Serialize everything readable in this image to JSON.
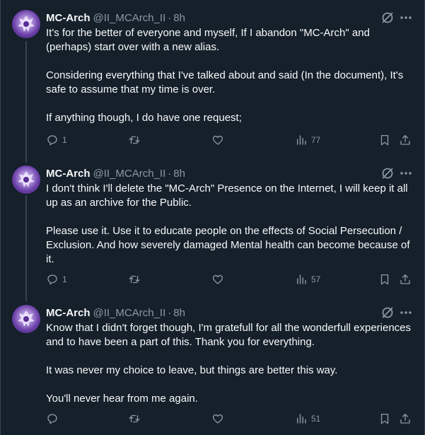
{
  "tweets": [
    {
      "name": "MC-Arch",
      "handle": "@II_MCArch_II",
      "separator": "·",
      "time": "8h",
      "paragraphs": [
        "It's for the better of everyone and myself, If I abandon \"MC-Arch\" and (perhaps) start over with a new alias.",
        "Considering everything that I've talked about and said (In the document), It's safe to assume that my time is over.",
        "If anything though, I do have one request;"
      ],
      "replies": "1",
      "retweets": "",
      "likes": "",
      "views": "77"
    },
    {
      "name": "MC-Arch",
      "handle": "@II_MCArch_II",
      "separator": "·",
      "time": "8h",
      "paragraphs": [
        "I don't think I'll delete the \"MC-Arch\" Presence on the Internet, I will keep it all up as an archive for the Public.",
        "Please use it. Use it to educate people on the effects of Social Persecution / Exclusion. And how severely damaged Mental health can become because of it."
      ],
      "replies": "1",
      "retweets": "",
      "likes": "",
      "views": "57"
    },
    {
      "name": "MC-Arch",
      "handle": "@II_MCArch_II",
      "separator": "·",
      "time": "8h",
      "paragraphs": [
        "Know that I didn't forget though, I'm gratefull for all the wonderfull experiences and to have been a part of this. Thank you for everything.",
        "It was never my choice to leave, but things are better this way.",
        "You'll never hear from me again."
      ],
      "replies": "",
      "retweets": "",
      "likes": "",
      "views": "51"
    }
  ],
  "icons": {
    "reply": "reply-icon",
    "retweet": "retweet-icon",
    "like": "like-icon",
    "views": "views-icon",
    "bookmark": "bookmark-icon",
    "share": "share-icon",
    "grok": "grok-icon",
    "more": "more-icon"
  },
  "colors": {
    "background": "#15202b",
    "text": "#f7f9f9",
    "secondary": "#8b98a5",
    "thread_line": "#38444d"
  }
}
